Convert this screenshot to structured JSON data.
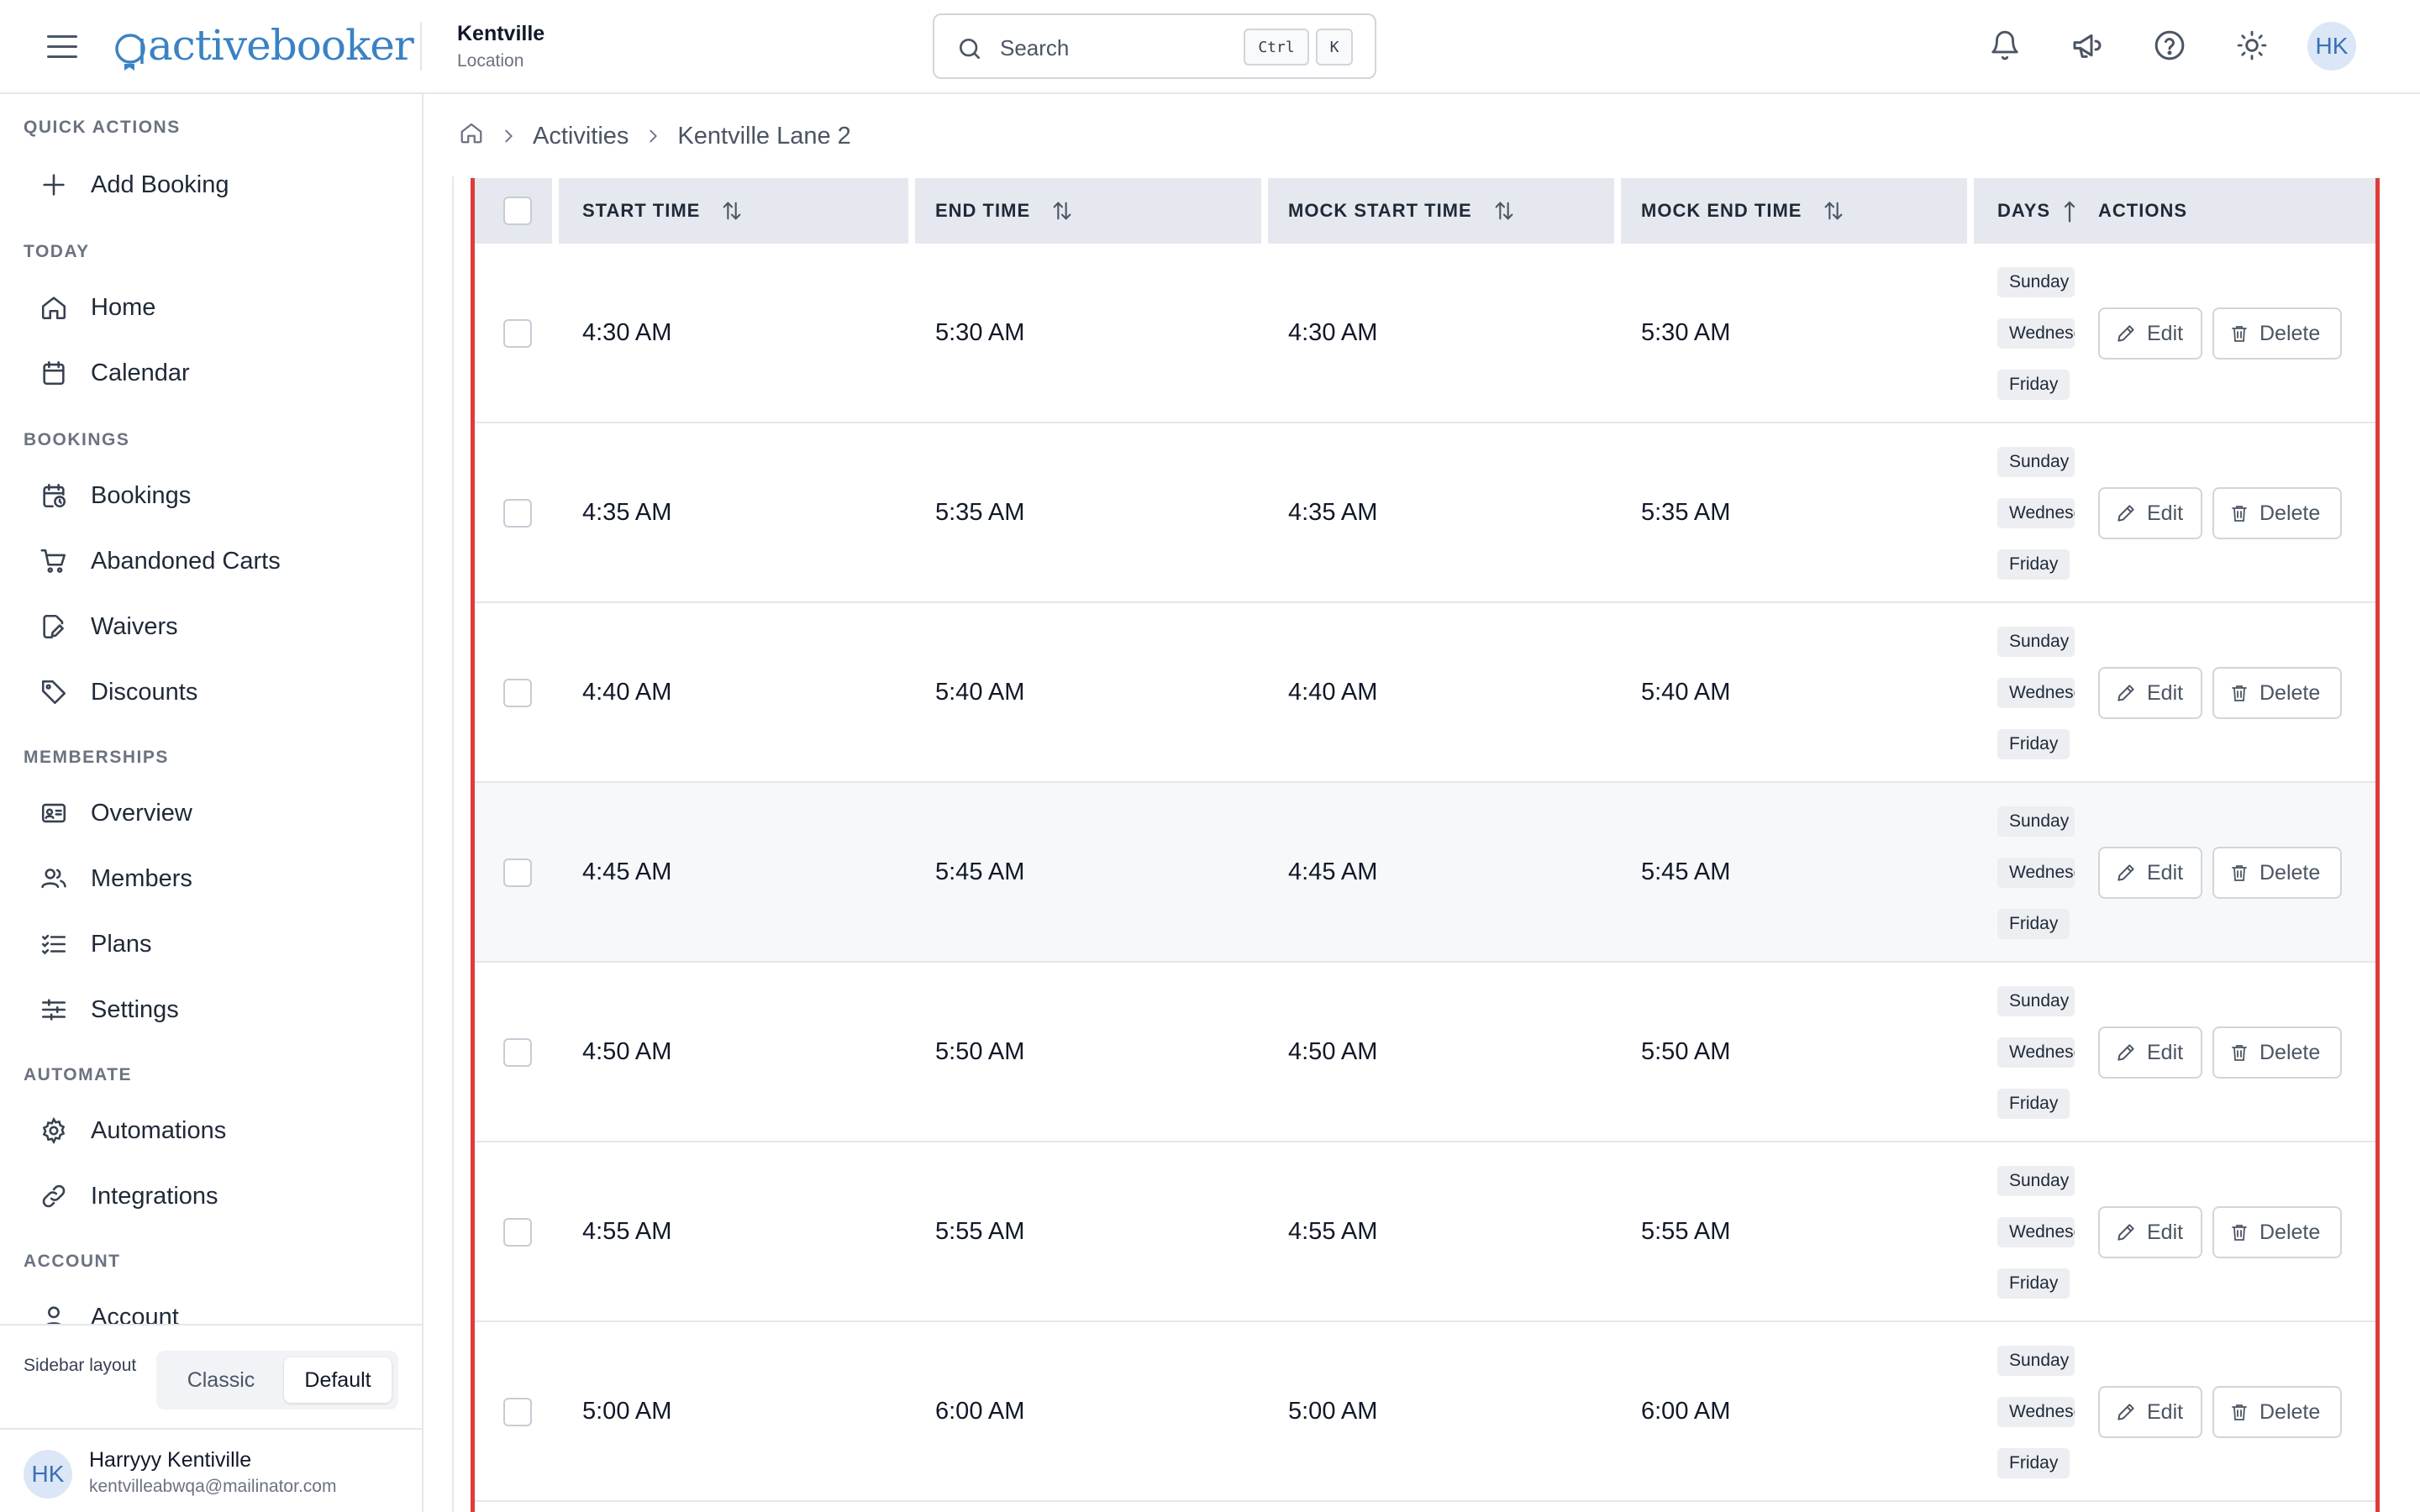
{
  "app": {
    "logo_text": "activebooker",
    "location_name": "Kentville",
    "location_sub": "Location",
    "search_placeholder": "Search",
    "kbd_ctrl": "Ctrl",
    "kbd_k": "K",
    "avatar_initials": "HK",
    "brand_color": "#3b82c4",
    "highlight_color": "#e03b3b"
  },
  "sidebar": {
    "sections": {
      "quick_actions": "QUICK ACTIONS",
      "today": "TODAY",
      "bookings": "BOOKINGS",
      "memberships": "MEMBERSHIPS",
      "automate": "AUTOMATE",
      "account": "ACCOUNT"
    },
    "items": {
      "add_booking": "Add Booking",
      "home": "Home",
      "calendar": "Calendar",
      "bookings": "Bookings",
      "abandoned_carts": "Abandoned Carts",
      "waivers": "Waivers",
      "discounts": "Discounts",
      "overview": "Overview",
      "members": "Members",
      "plans": "Plans",
      "settings": "Settings",
      "automations": "Automations",
      "integrations": "Integrations",
      "account": "Account"
    },
    "layout_label": "Sidebar layout",
    "layout_classic": "Classic",
    "layout_default": "Default",
    "user_initials": "HK",
    "user_name": "Harryyy Kentiville",
    "user_email": "kentvilleabwqa@mailinator.com"
  },
  "breadcrumb": {
    "activities": "Activities",
    "current": "Kentville Lane 2"
  },
  "table": {
    "headers": {
      "start_time": "START TIME",
      "end_time": "END TIME",
      "mock_start_time": "MOCK START TIME",
      "mock_end_time": "MOCK END TIME",
      "days": "DAYS",
      "actions": "ACTIONS"
    },
    "edit_label": "Edit",
    "delete_label": "Delete",
    "rows": [
      {
        "start": "4:30 AM",
        "end": "5:30 AM",
        "mock_start": "4:30 AM",
        "mock_end": "5:30 AM",
        "days": [
          "Sunday",
          "Wednesday",
          "Friday"
        ]
      },
      {
        "start": "4:35 AM",
        "end": "5:35 AM",
        "mock_start": "4:35 AM",
        "mock_end": "5:35 AM",
        "days": [
          "Sunday",
          "Wednesday",
          "Friday"
        ]
      },
      {
        "start": "4:40 AM",
        "end": "5:40 AM",
        "mock_start": "4:40 AM",
        "mock_end": "5:40 AM",
        "days": [
          "Sunday",
          "Wednesday",
          "Friday"
        ]
      },
      {
        "start": "4:45 AM",
        "end": "5:45 AM",
        "mock_start": "4:45 AM",
        "mock_end": "5:45 AM",
        "days": [
          "Sunday",
          "Wednesday",
          "Friday"
        ]
      },
      {
        "start": "4:50 AM",
        "end": "5:50 AM",
        "mock_start": "4:50 AM",
        "mock_end": "5:50 AM",
        "days": [
          "Sunday",
          "Wednesday",
          "Friday"
        ]
      },
      {
        "start": "4:55 AM",
        "end": "5:55 AM",
        "mock_start": "4:55 AM",
        "mock_end": "5:55 AM",
        "days": [
          "Sunday",
          "Wednesday",
          "Friday"
        ]
      },
      {
        "start": "5:00 AM",
        "end": "6:00 AM",
        "mock_start": "5:00 AM",
        "mock_end": "6:00 AM",
        "days": [
          "Sunday",
          "Wednesday",
          "Friday"
        ]
      }
    ]
  }
}
